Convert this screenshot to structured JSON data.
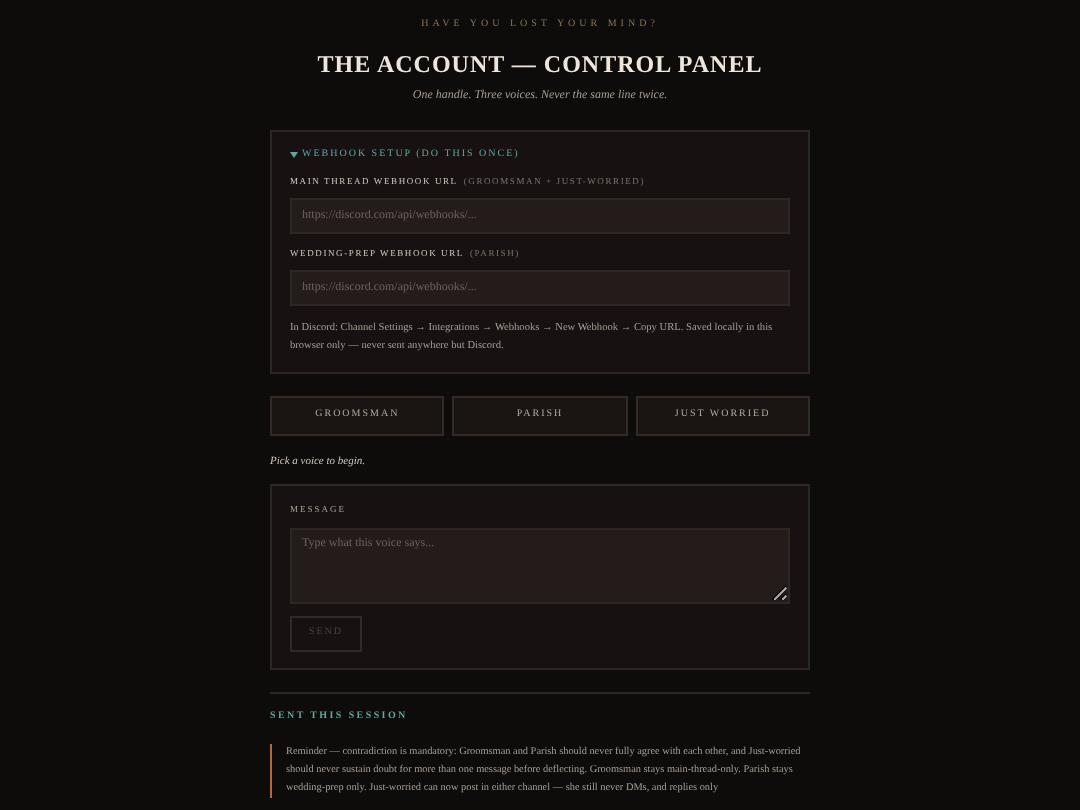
{
  "header": {
    "kicker": "HAVE YOU LOST YOUR MIND?",
    "title": "THE ACCOUNT — CONTROL PANEL",
    "subtitle": "One handle. Three voices. Never the same line twice."
  },
  "webhook_setup": {
    "summary": "WEBHOOK SETUP (DO THIS ONCE)",
    "expanded": true,
    "fields": [
      {
        "label": "MAIN THREAD WEBHOOK URL",
        "note": "(GROOMSMAN + JUST-WORRIED)",
        "placeholder": "https://discord.com/api/webhooks/..."
      },
      {
        "label": "WEDDING-PREP WEBHOOK URL",
        "note": "(PARISH)",
        "placeholder": "https://discord.com/api/webhooks/..."
      }
    ],
    "help": "In Discord: Channel Settings → Integrations → Webhooks → New Webhook → Copy URL. Saved locally in this browser only — never sent anywhere but Discord."
  },
  "voices": [
    {
      "label": "GROOMSMAN",
      "selected": false
    },
    {
      "label": "PARISH",
      "selected": false
    },
    {
      "label": "JUST WORRIED",
      "selected": false
    }
  ],
  "voice_hint": "Pick a voice to begin.",
  "message": {
    "label": "MESSAGE",
    "placeholder": "Type what this voice says...",
    "send": "SEND",
    "send_disabled": true
  },
  "sent": {
    "heading": "SENT THIS SESSION",
    "reminder": "Reminder — contradiction is mandatory: Groomsman and Parish should never fully agree with each other, and Just-worried should never sustain doubt for more than one message before deflecting. Groomsman stays main-thread-only. Parish stays wedding-prep only. Just-worried can now post in either channel — she still never DMs, and replies only"
  }
}
